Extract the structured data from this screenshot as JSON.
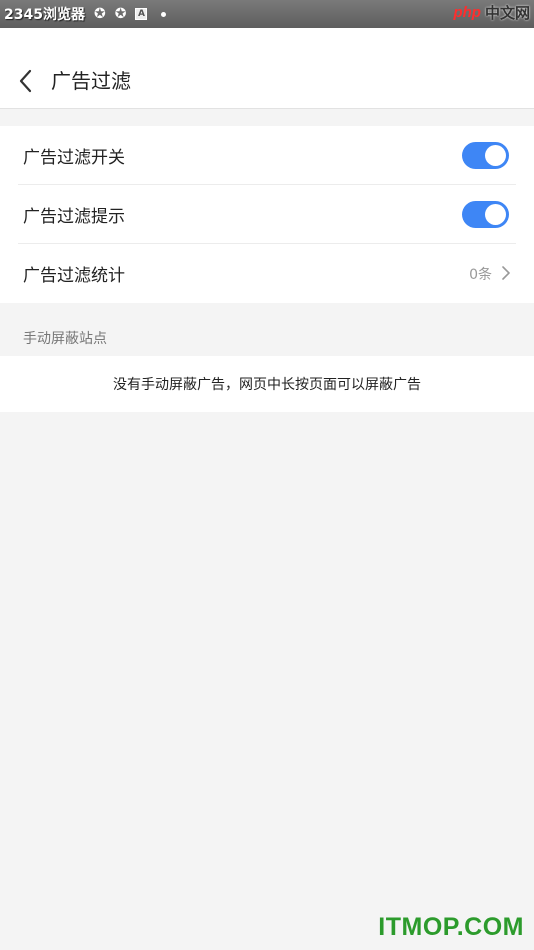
{
  "status_bar": {
    "app_name": "2345浏览器",
    "icons": [
      "compass-icon",
      "compass-icon",
      "a-badge-icon",
      "dot-icon"
    ],
    "site_logo": "php",
    "site_name": "中文网"
  },
  "header": {
    "back_icon": "chevron-left-icon",
    "title": "广告过滤"
  },
  "settings": {
    "items": [
      {
        "label": "广告过滤开关",
        "type": "toggle",
        "on": true
      },
      {
        "label": "广告过滤提示",
        "type": "toggle",
        "on": true
      },
      {
        "label": "广告过滤统计",
        "type": "link",
        "value": "0条"
      }
    ]
  },
  "manual_block": {
    "section_title": "手动屏蔽站点",
    "empty_message": "没有手动屏蔽广告，网页中长按页面可以屏蔽广告"
  },
  "watermark": "ITMOP.COM",
  "colors": {
    "accent": "#3e86f5",
    "background": "#f4f4f4",
    "watermark": "#2c9b2c",
    "php_logo": "#ff2d2d"
  }
}
